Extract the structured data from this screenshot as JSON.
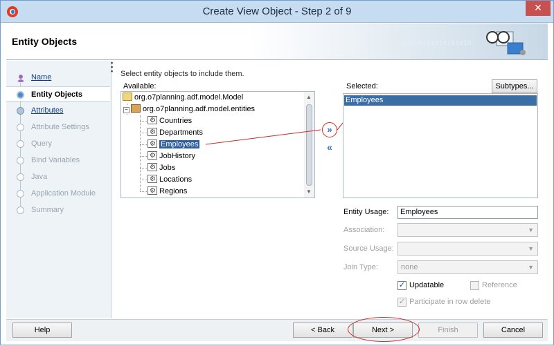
{
  "window": {
    "title": "Create View Object - Step 2 of 9",
    "close_glyph": "✕"
  },
  "header": {
    "title": "Entity Objects",
    "binary_text": "0101010101010101010101010"
  },
  "nav": {
    "items": [
      {
        "label": "Name",
        "state": "done-link"
      },
      {
        "label": "Entity Objects",
        "state": "current"
      },
      {
        "label": "Attributes",
        "state": "link"
      },
      {
        "label": "Attribute Settings",
        "state": "disabled"
      },
      {
        "label": "Query",
        "state": "disabled"
      },
      {
        "label": "Bind Variables",
        "state": "disabled"
      },
      {
        "label": "Java",
        "state": "disabled"
      },
      {
        "label": "Application Module",
        "state": "disabled"
      },
      {
        "label": "Summary",
        "state": "disabled"
      }
    ]
  },
  "main": {
    "instruction": "Select entity objects to include them.",
    "available_label": "Available:",
    "selected_label": "Selected:",
    "subtypes_label": "Subtypes...",
    "tree": {
      "root": "org.o7planning.adf.model.Model",
      "package": "org.o7planning.adf.model.entities",
      "entities": [
        "Countries",
        "Departments",
        "Employees",
        "JobHistory",
        "Jobs",
        "Locations",
        "Regions"
      ]
    },
    "selected_items": [
      "Employees"
    ],
    "shuttle": {
      "add_glyph": "»",
      "remove_glyph": "«"
    },
    "form": {
      "entity_usage_label": "Entity Usage:",
      "entity_usage_value": "Employees",
      "association_label": "Association:",
      "association_value": "",
      "source_usage_label": "Source Usage:",
      "source_usage_value": "",
      "join_type_label": "Join Type:",
      "join_type_value": "none",
      "updatable_label": "Updatable",
      "updatable_checked": true,
      "reference_label": "Reference",
      "reference_checked": false,
      "participate_label": "Participate in row delete",
      "participate_checked": true
    }
  },
  "footer": {
    "help_label": "Help",
    "back_label": "< Back",
    "next_label": "Next >",
    "finish_label": "Finish",
    "cancel_label": "Cancel"
  },
  "colors": {
    "selection": "#3a6ea5",
    "annotation_red": "#cc2a2a",
    "titlebar": "#c6dcf1"
  }
}
